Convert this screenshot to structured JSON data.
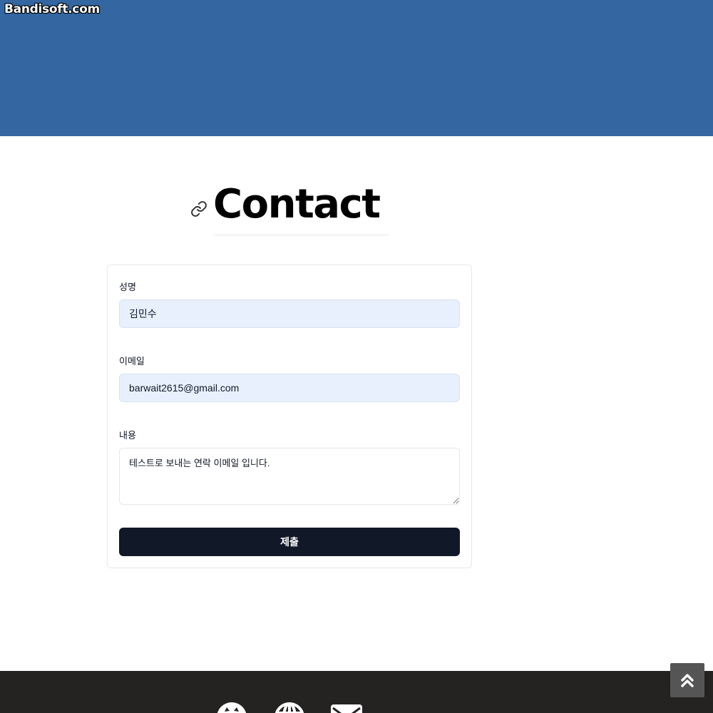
{
  "watermark": "Bandisoft.com",
  "page": {
    "title": "Contact"
  },
  "form": {
    "name_label": "성명",
    "name_value": "김민수",
    "email_label": "이메일",
    "email_value": "barwait2615@gmail.com",
    "message_label": "내용",
    "message_value": "테스트로 보내는 연락 이메일 입니다.",
    "submit_label": "제출"
  },
  "footer": {
    "icons": [
      "github-icon",
      "globe-icon",
      "mail-icon"
    ]
  },
  "colors": {
    "header": "#3467a1",
    "submit": "#111827",
    "footer": "#252222",
    "input_autofill": "#e8f0fe",
    "scroll_top": "#555555"
  }
}
